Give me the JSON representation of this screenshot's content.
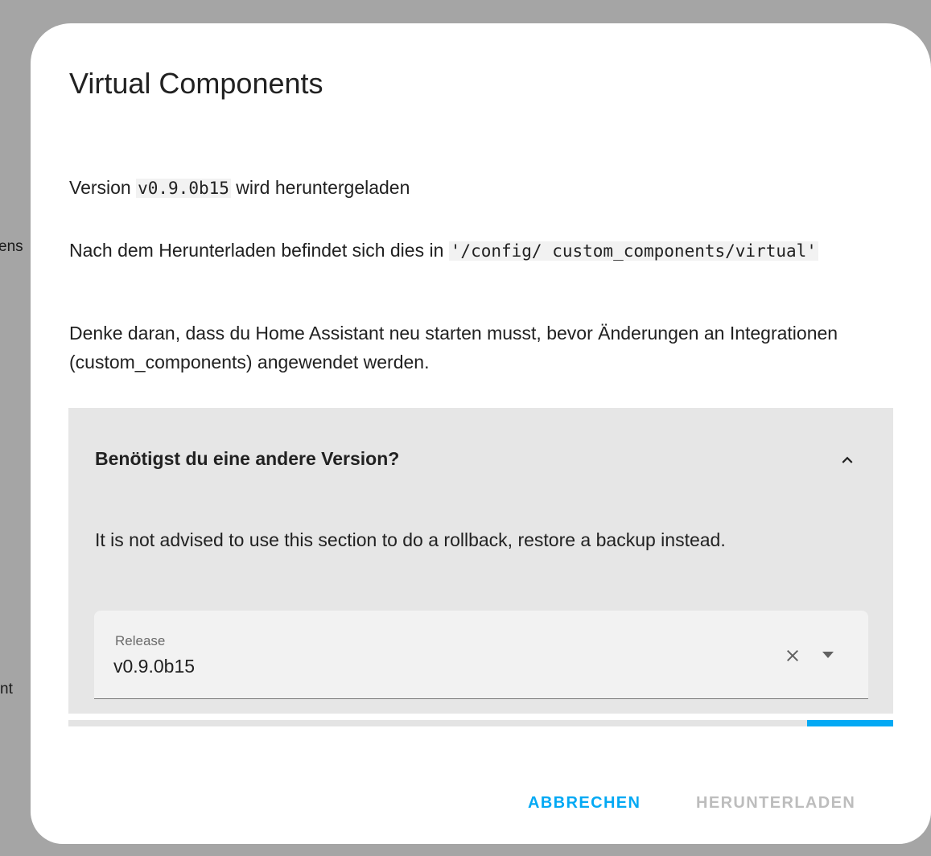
{
  "background": {
    "fragment_1": "ens",
    "fragment_2": "nt"
  },
  "dialog": {
    "title": "Virtual Components",
    "version_prefix": "Version ",
    "version_code": "v0.9.0b15",
    "version_suffix": " wird heruntergeladen",
    "location_prefix": "Nach dem Herunterladen befindet sich dies in ",
    "location_path": "'/config/ custom_components/virtual'",
    "restart_notice": "Denke daran, dass du Home Assistant neu starten musst, bevor Änderungen an Integrationen (custom_components) angewendet werden.",
    "expander": {
      "title": "Benötigst du eine andere Version?",
      "expanded": true,
      "chevron_icon": "chevron-up-icon",
      "warning": "It is not advised to use this section to do a rollback, restore a backup instead.",
      "release_select": {
        "label": "Release",
        "value": "v0.9.0b15",
        "clear_icon": "close-icon",
        "dropdown_icon": "arrow-down-icon"
      }
    },
    "progress": {
      "indeterminate": true,
      "color": "#03a9f4"
    },
    "actions": {
      "cancel_label": "ABBRECHEN",
      "download_label": "HERUNTERLADEN",
      "accent_color": "#03a9f4",
      "disabled_color": "#bdbdbd"
    }
  }
}
